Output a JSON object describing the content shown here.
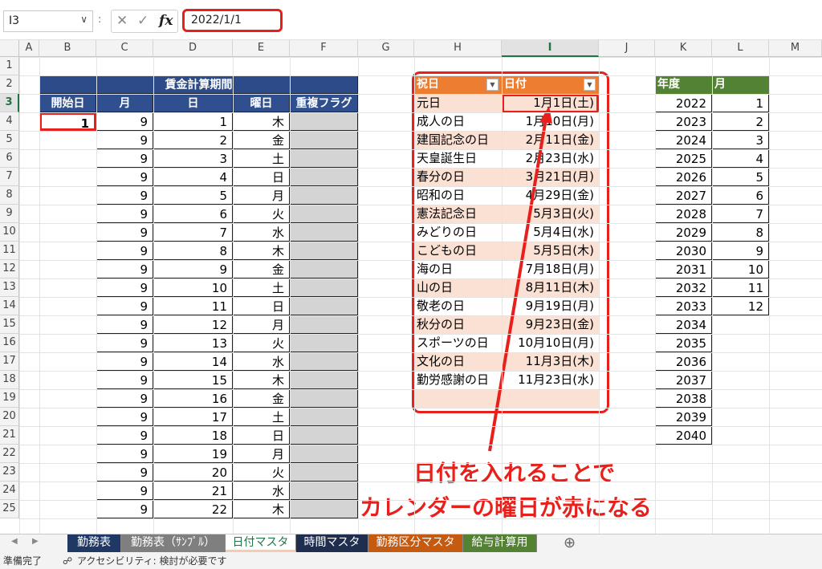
{
  "formula_bar": {
    "name_box": "I3",
    "separator": ":",
    "cancel_icon": "✕",
    "enter_icon": "✓",
    "fx_label": "fx",
    "value": "2022/1/1"
  },
  "columns": [
    "A",
    "B",
    "C",
    "D",
    "E",
    "F",
    "G",
    "H",
    "I",
    "J",
    "K",
    "L",
    "M"
  ],
  "rows": [
    "1",
    "2",
    "3",
    "4",
    "5",
    "6",
    "7",
    "8",
    "9",
    "10",
    "11",
    "12",
    "13",
    "14",
    "15",
    "16",
    "17",
    "18",
    "19",
    "20",
    "21",
    "22",
    "23",
    "24",
    "25"
  ],
  "wage_table": {
    "title": "賃金計算期間",
    "headers": [
      "開始日",
      "月",
      "日",
      "曜日",
      "重複フラグ"
    ],
    "start_day": "1",
    "month": "9",
    "days": [
      "1",
      "2",
      "3",
      "4",
      "5",
      "6",
      "7",
      "8",
      "9",
      "10",
      "11",
      "12",
      "13",
      "14",
      "15",
      "16",
      "17",
      "18",
      "19",
      "20",
      "21",
      "22"
    ],
    "weekdays": [
      "木",
      "金",
      "土",
      "日",
      "月",
      "火",
      "水",
      "木",
      "金",
      "土",
      "日",
      "月",
      "火",
      "水",
      "木",
      "金",
      "土",
      "日",
      "月",
      "火",
      "水",
      "木"
    ]
  },
  "holiday_table": {
    "headers": [
      "祝日",
      "日付"
    ],
    "filter_icon": "▼",
    "rows": [
      {
        "name": "元日",
        "date": "1月1日(土)"
      },
      {
        "name": "成人の日",
        "date": "1月10日(月)"
      },
      {
        "name": "建国記念の日",
        "date": "2月11日(金)"
      },
      {
        "name": "天皇誕生日",
        "date": "2月23日(水)"
      },
      {
        "name": "春分の日",
        "date": "3月21日(月)"
      },
      {
        "name": "昭和の日",
        "date": "4月29日(金)"
      },
      {
        "name": "憲法記念日",
        "date": "5月3日(火)"
      },
      {
        "name": "みどりの日",
        "date": "5月4日(水)"
      },
      {
        "name": "こどもの日",
        "date": "5月5日(木)"
      },
      {
        "name": "海の日",
        "date": "7月18日(月)"
      },
      {
        "name": "山の日",
        "date": "8月11日(木)"
      },
      {
        "name": "敬老の日",
        "date": "9月19日(月)"
      },
      {
        "name": "秋分の日",
        "date": "9月23日(金)"
      },
      {
        "name": "スポーツの日",
        "date": "10月10日(月)"
      },
      {
        "name": "文化の日",
        "date": "11月3日(木)"
      },
      {
        "name": "勤労感謝の日",
        "date": "11月23日(水)"
      }
    ]
  },
  "year_table": {
    "headers": [
      "年度",
      "月"
    ],
    "years": [
      "2022",
      "2023",
      "2024",
      "2025",
      "2026",
      "2027",
      "2028",
      "2029",
      "2030",
      "2031",
      "2032",
      "2033",
      "2034",
      "2035",
      "2036",
      "2037",
      "2038",
      "2039",
      "2040"
    ],
    "months": [
      "1",
      "2",
      "3",
      "4",
      "5",
      "6",
      "7",
      "8",
      "9",
      "10",
      "11",
      "12"
    ]
  },
  "annotation": {
    "line1": "日付を入れることで",
    "line2": "カレンダーの曜日が赤になる",
    "color": "#e8201c"
  },
  "tabs": [
    {
      "label": "勤務表",
      "color": "#1f3864"
    },
    {
      "label": "勤務表（ｻﾝﾌﾟﾙ）",
      "color": "#7f7f7f"
    },
    {
      "label": "日付マスタ",
      "color": "#f8cbad"
    },
    {
      "label": "時間マスタ",
      "color": "#1f2d4f"
    },
    {
      "label": "勤務区分マスタ",
      "color": "#c55a11"
    },
    {
      "label": "給与計算用",
      "color": "#548235"
    }
  ],
  "add_sheet_icon": "⊕",
  "tab_nav": {
    "prev": "◀",
    "next": "▶"
  },
  "status": {
    "ready": "準備完了",
    "accessibility": "アクセシビリティ: 検討が必要です"
  }
}
